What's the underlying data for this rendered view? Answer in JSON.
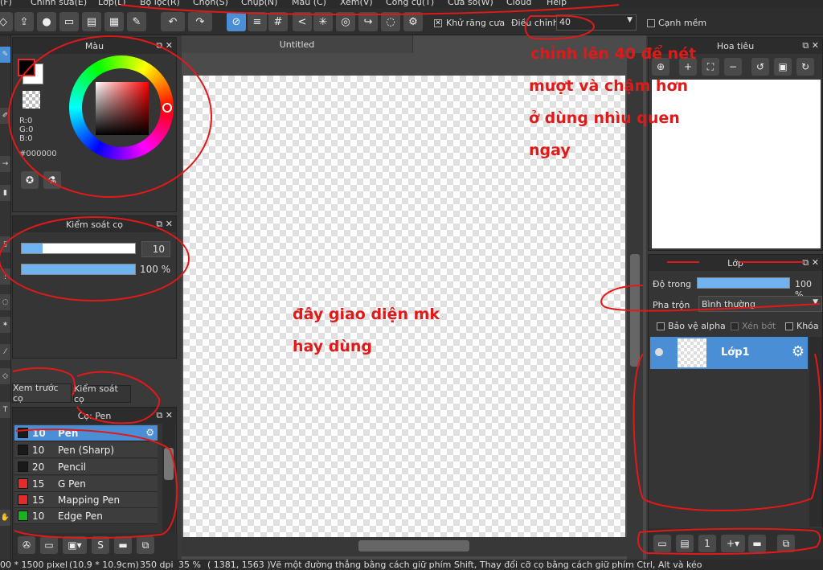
{
  "menu": [
    "(F)",
    "Chỉnh sửa(E)",
    "Lớp(L)",
    "Bộ lọc(R)",
    "Chọn(S)",
    "Chụp(N)",
    "Màu (C)",
    "Xem(V)",
    "Công cụ(T)",
    "Cửa sổ(W)",
    "Cloud",
    "Help"
  ],
  "toolbar": {
    "antialias_label": "Khử răng cưa",
    "correction_label": "Điều chỉnh",
    "correction_value": "40",
    "soft_edge_label": "Cạnh mềm"
  },
  "color_panel": {
    "title": "Màu",
    "r": "R:0",
    "g": "G:0",
    "b": "B:0",
    "hex": "#000000",
    "fg_color": "#000000",
    "bg_color": "#ffffff"
  },
  "brush_control": {
    "title": "Kiểm soát cọ",
    "size": "10",
    "opacity": "100 %"
  },
  "tabs": {
    "preview": "Xem trước cọ",
    "brush_control": "Kiểm soát cọ"
  },
  "brush_panel": {
    "title": "Cọ: Pen",
    "brushes": [
      {
        "size": "10",
        "name": "Pen",
        "color": "#1a1a1a",
        "selected": true
      },
      {
        "size": "10",
        "name": "Pen (Sharp)",
        "color": "#1a1a1a"
      },
      {
        "size": "20",
        "name": "Pencil",
        "color": "#1a1a1a"
      },
      {
        "size": "15",
        "name": "G Pen",
        "color": "#e32b2b"
      },
      {
        "size": "15",
        "name": "Mapping Pen",
        "color": "#e32b2b"
      },
      {
        "size": "10",
        "name": "Edge Pen",
        "color": "#19b21f"
      }
    ]
  },
  "canvas": {
    "tab_title": "Untitled"
  },
  "navigator": {
    "title": "Hoa tiêu"
  },
  "layer_panel": {
    "title": "Lớp",
    "opacity_label": "Độ trong",
    "opacity_value": "100 %",
    "opacity_fraction": 1.0,
    "blend_label": "Pha trộn",
    "blend_value": "Bình thường",
    "protect_alpha": "Bảo vệ alpha",
    "clipping": "Xén bớt",
    "lock": "Khóa",
    "layer_name": "Lớp1"
  },
  "status": {
    "size": "00 * 1500 pixel",
    "cm": "(10.9 * 10.9cm)",
    "dpi": "350 dpi",
    "zoom": "35 %",
    "coords": "( 1381, 1563 )",
    "hint": "Vẽ một đường thẳng bằng cách giữ phím Shift, Thay đổi cỡ cọ bằng cách giữ phím Ctrl, Alt và kéo"
  },
  "annotations": {
    "top_right": [
      "chỉnh lên 40 để nét",
      "mượt và chậm hơn",
      "ở dùng nhìu quen",
      "ngay"
    ],
    "center": [
      "đây giao diện mk",
      "hay dùng"
    ],
    "ink_color": "#e11919"
  }
}
